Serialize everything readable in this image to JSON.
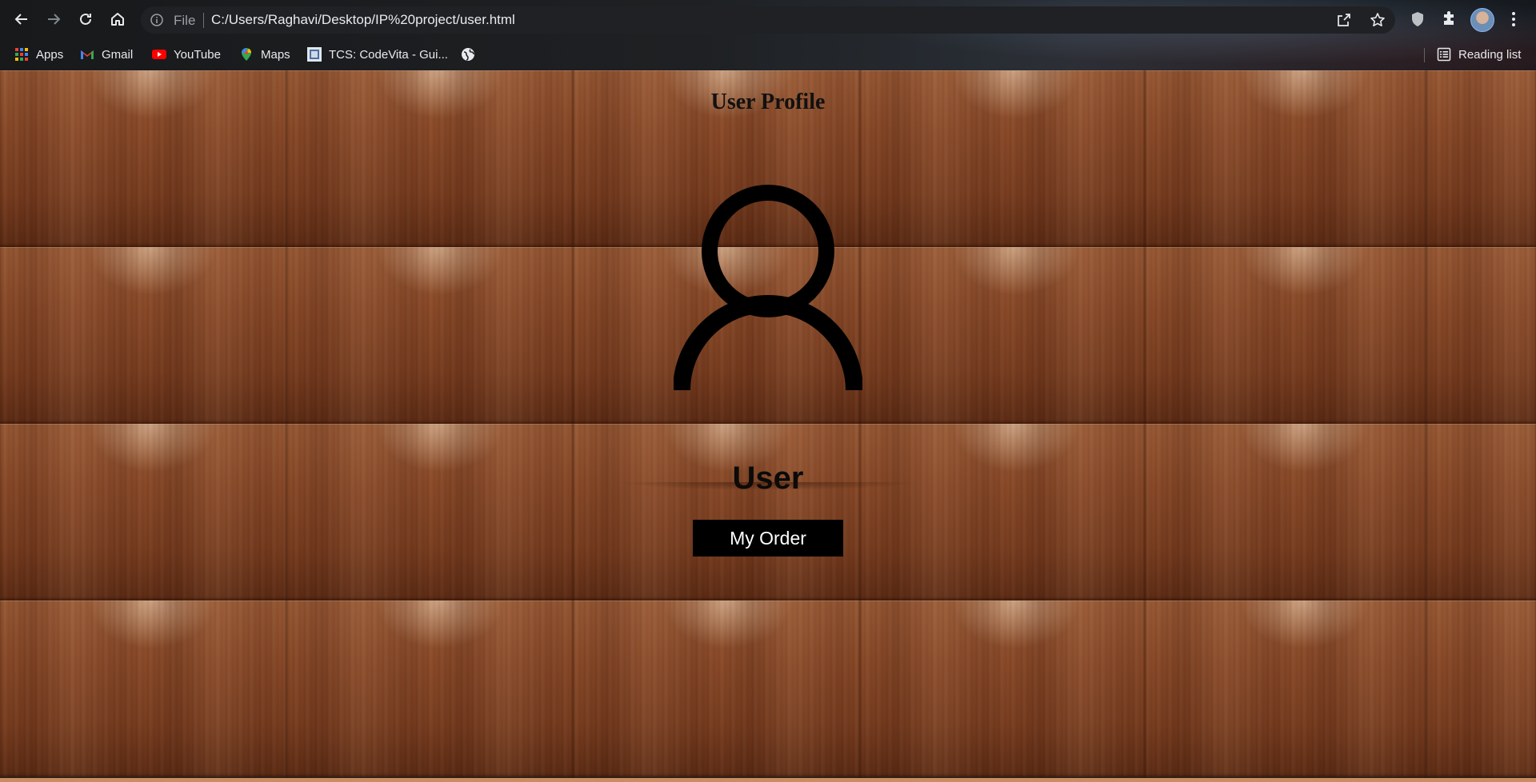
{
  "browser": {
    "omnibox": {
      "scheme_label": "File",
      "url": "C:/Users/Raghavi/Desktop/IP%20project/user.html"
    },
    "icons": {
      "back": "back-arrow-icon",
      "forward": "forward-arrow-icon",
      "reload": "reload-icon",
      "home": "home-icon",
      "info": "info-icon",
      "share": "share-icon",
      "bookmark_star": "star-icon",
      "shield": "shield-icon",
      "extensions": "puzzle-icon",
      "profile": "avatar",
      "menu": "kebab-menu-icon"
    },
    "bookmarks": [
      {
        "label": "Apps",
        "icon": "apps-grid-icon"
      },
      {
        "label": "Gmail",
        "icon": "gmail-icon"
      },
      {
        "label": "YouTube",
        "icon": "youtube-icon"
      },
      {
        "label": "Maps",
        "icon": "maps-pin-icon"
      },
      {
        "label": "TCS: CodeVita - Gui...",
        "icon": "codevita-icon"
      },
      {
        "label": "",
        "icon": "globe-icon"
      }
    ],
    "reading_list": {
      "label": "Reading list",
      "icon": "reading-list-icon"
    }
  },
  "page": {
    "title": "User Profile",
    "user_name": "User",
    "order_button": "My Order",
    "colors": {
      "wood_base": "#8a4a28",
      "text": "#111111",
      "button_bg": "#000000",
      "button_text": "#ffffff"
    }
  }
}
